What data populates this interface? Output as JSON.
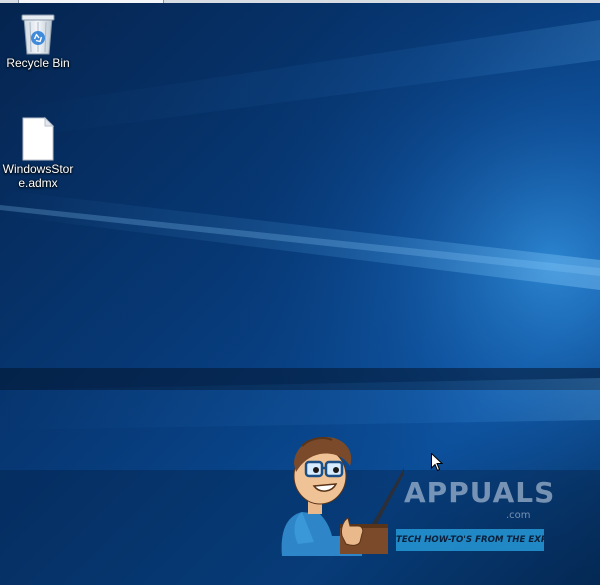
{
  "desktop": {
    "icons": [
      {
        "label": "Recycle Bin",
        "icon": "recycle-bin-icon"
      },
      {
        "label": "WindowsStore.admx",
        "icon": "document-file-icon"
      }
    ]
  },
  "watermark": {
    "brand": "APPUALS",
    "domain_suffix": ".com",
    "tagline": "TECH HOW-TO'S FROM THE EXPERTS!"
  },
  "cursor": {
    "icon": "arrow-pointer-icon"
  },
  "colors": {
    "wallpaper_dark": "#041a3a",
    "wallpaper_mid": "#0a4a8f",
    "wallpaper_light": "#2e8ee0",
    "tagline_bg": "#2698d6",
    "label_text": "#ffffff"
  }
}
